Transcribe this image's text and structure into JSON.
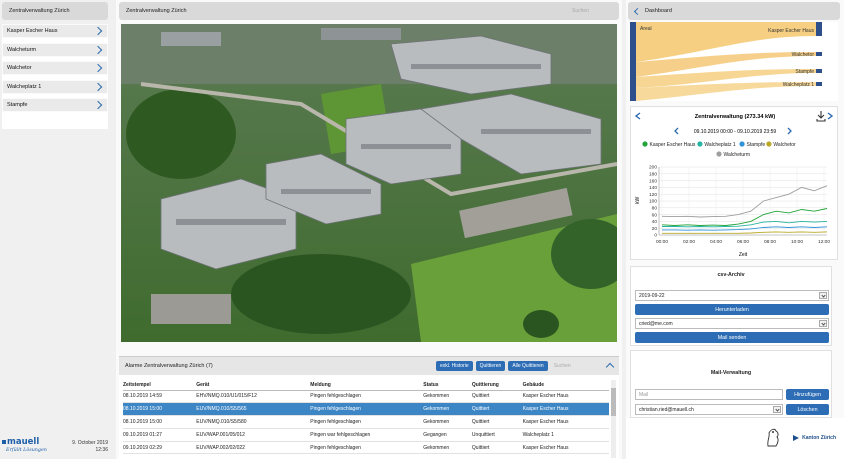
{
  "left": {
    "title": "Zentralverwaltung Zürich",
    "items": [
      {
        "label": "Kasper Escher Haus"
      },
      {
        "label": "Walcheturm"
      },
      {
        "label": "Walchetor"
      },
      {
        "label": "Walcheplatz 1"
      },
      {
        "label": "Stampfe"
      }
    ],
    "logo_text": "mauell",
    "logo_tagline": "Erfüllt Lösungen",
    "date": "9. October 2019",
    "time": "12:36"
  },
  "center": {
    "title": "Zentralverwaltung Zürich",
    "search_placeholder": "Suchen",
    "photo_name": "campus-aerial-photo"
  },
  "alarms": {
    "title": "Alarme Zentralverwaltung Zürich (7)",
    "buttons": {
      "history": "exkl. Historie",
      "ack": "Quittieren",
      "ack_all": "Alle Quittieren"
    },
    "search_placeholder": "Suchen",
    "columns": [
      "Zeitstempel",
      "Gerät",
      "Meldung",
      "Status",
      "Quittierung",
      "Gebäude"
    ],
    "rows": [
      {
        "time": "08.10.2019 14:59",
        "device": "EHV/NMQ.010/U1/015/F12",
        "message": "Pingen fehlgeschlagen",
        "status": "Gekommen",
        "ack": "Quittiert",
        "building": "Kasper Escher Haus"
      },
      {
        "time": "08.10.2019 15:00",
        "device": "EUV/NMQ.010/S5/565",
        "message": "Pingen fehlgeschlagen",
        "status": "Gekommen",
        "ack": "Quittiert",
        "building": "Kasper Escher Haus"
      },
      {
        "time": "08.10.2019 15:00",
        "device": "EUV/NMQ.010/S5/580",
        "message": "Pingen fehlgeschlagen",
        "status": "Gekommen",
        "ack": "Quittiert",
        "building": "Kasper Escher Haus"
      },
      {
        "time": "09.10.2019 01:27",
        "device": "EUV/WAP.001/05/012",
        "message": "Pingen war fehlgeschlagen",
        "status": "Gegangen",
        "ack": "Unquittiert",
        "building": "Walcheplatz 1"
      },
      {
        "time": "09.10.2019 02:29",
        "device": "EUV/WAP.002/02/022",
        "message": "Pingen fehlgeschlagen",
        "status": "Gekommen",
        "ack": "Quittiert",
        "building": "Kasper Escher Haus"
      }
    ],
    "selected_row_index": 1
  },
  "right": {
    "dashboard_label": "Dashboard",
    "sankey": {
      "source": "Areal",
      "targets": [
        "Kasper Escher Haus",
        "Walchetor",
        "Stampfe",
        "Walcheplatz 1"
      ]
    },
    "chart_title": "Zentralverwaltung (273.34 kW)",
    "date_range": "09.10.2019 00:00 - 09.10.2019 23:59",
    "csv": {
      "title": "csv-Archiv",
      "date_value": "2019-09-22",
      "download_label": "Herunterladen",
      "email_value": "cried@me.com",
      "send_label": "Mail senden"
    },
    "mail": {
      "title": "Mail-Verwaltung",
      "input_placeholder": "Mail",
      "add_label": "Hinzufügen",
      "selected_email": "christian.ried@mauell.ch",
      "delete_label": "Löschen"
    },
    "kanton_label": "Kanton Zürich",
    "colors": {
      "kasper": "#22a53a",
      "walcheplatz": "#27b4a3",
      "stampfe": "#2f93d8",
      "walchetor": "#b9a825",
      "walcheturm": "#9e9e9e",
      "accent": "#2d6db5"
    }
  },
  "chart_data": {
    "type": "line",
    "title": "Zentralverwaltung (273.34 kW)",
    "ylabel": "kW",
    "xlabel": "Zeit",
    "ylim": [
      0,
      200
    ],
    "yticks": [
      0,
      20,
      40,
      60,
      80,
      100,
      120,
      140,
      160,
      180,
      200
    ],
    "xticks": [
      "00:00",
      "02:00",
      "04:00",
      "06:00",
      "08:00",
      "10:00",
      "12:00"
    ],
    "x": [
      "00:00",
      "01:00",
      "02:00",
      "03:00",
      "04:00",
      "05:00",
      "06:00",
      "07:00",
      "08:00",
      "09:00",
      "10:00",
      "11:00",
      "12:00",
      "12:30"
    ],
    "series": [
      {
        "name": "Kasper Escher Haus",
        "values": [
          30,
          28,
          30,
          28,
          29,
          28,
          32,
          40,
          60,
          70,
          65,
          75,
          70,
          78
        ]
      },
      {
        "name": "Walcheplatz 1",
        "values": [
          25,
          25,
          24,
          25,
          24,
          25,
          26,
          30,
          38,
          40,
          36,
          40,
          38,
          40
        ]
      },
      {
        "name": "Stampfe",
        "values": [
          15,
          15,
          14,
          15,
          14,
          15,
          16,
          18,
          22,
          24,
          22,
          24,
          22,
          24
        ]
      },
      {
        "name": "Walchetor",
        "values": [
          5,
          5,
          5,
          5,
          5,
          5,
          5,
          6,
          8,
          9,
          8,
          9,
          8,
          9
        ]
      },
      {
        "name": "Walcheturm",
        "values": [
          55,
          54,
          55,
          53,
          54,
          55,
          60,
          70,
          100,
          110,
          120,
          140,
          130,
          145
        ]
      }
    ],
    "legend_position": "top"
  }
}
